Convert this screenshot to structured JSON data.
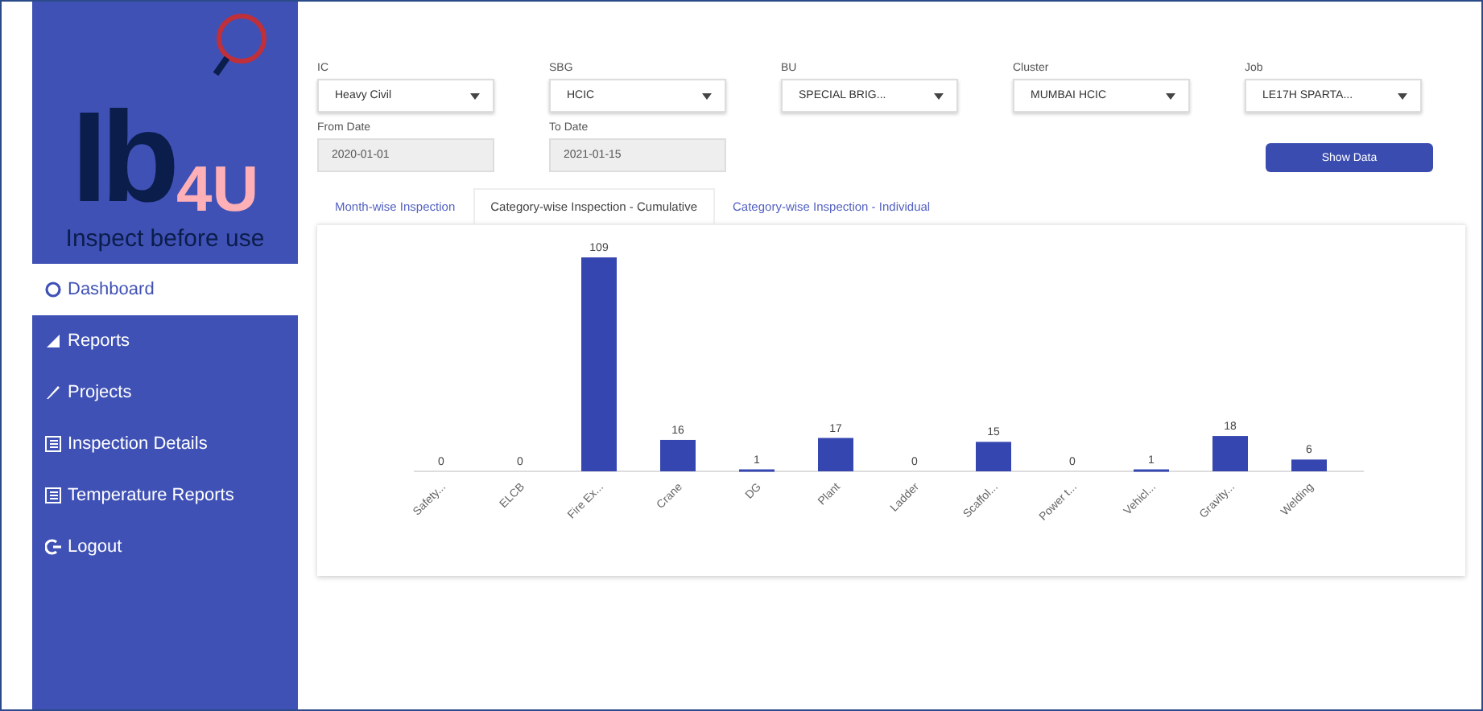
{
  "logo": {
    "letters": "Ib",
    "accent": "4U",
    "tagline": "Inspect before use"
  },
  "sidebar": {
    "items": [
      {
        "label": "Dashboard",
        "kind": "dashboard",
        "selected": true
      },
      {
        "label": "Reports",
        "kind": "chart",
        "selected": false
      },
      {
        "label": "Projects",
        "kind": "pencil",
        "selected": false
      },
      {
        "label": "Inspection Details",
        "kind": "list",
        "selected": false
      },
      {
        "label": "Temperature Reports",
        "kind": "list",
        "selected": false
      },
      {
        "label": "Logout",
        "kind": "logout",
        "selected": false
      }
    ]
  },
  "filters": [
    {
      "label": "IC",
      "value": "Heavy Civil"
    },
    {
      "label": "SBG",
      "value": "HCIC"
    },
    {
      "label": "BU",
      "value": "SPECIAL BRIG..."
    },
    {
      "label": "Cluster",
      "value": "MUMBAI HCIC"
    },
    {
      "label": "Job",
      "value": "LE17H SPARTA..."
    }
  ],
  "dates": [
    {
      "label": "From Date",
      "value": "2020-01-01"
    },
    {
      "label": "To Date",
      "value": "2021-01-15"
    }
  ],
  "show_button": "Show Data",
  "tabs": [
    {
      "label": "Month-wise Inspection",
      "selected": false
    },
    {
      "label": "Category-wise Inspection - Cumulative",
      "selected": true
    },
    {
      "label": "Category-wise Inspection - Individual",
      "selected": false
    }
  ],
  "chart_data": {
    "type": "bar",
    "data_labels": true,
    "categories": [
      "Safety...",
      "ELCB",
      "Fire Ex...",
      "Crane",
      "DG",
      "Plant",
      "Ladder",
      "Scaffol...",
      "Power t...",
      "Vehicl...",
      "Gravity...",
      "Welding"
    ],
    "values": [
      0,
      0,
      109,
      16,
      1,
      17,
      0,
      15,
      0,
      1,
      18,
      6
    ]
  }
}
